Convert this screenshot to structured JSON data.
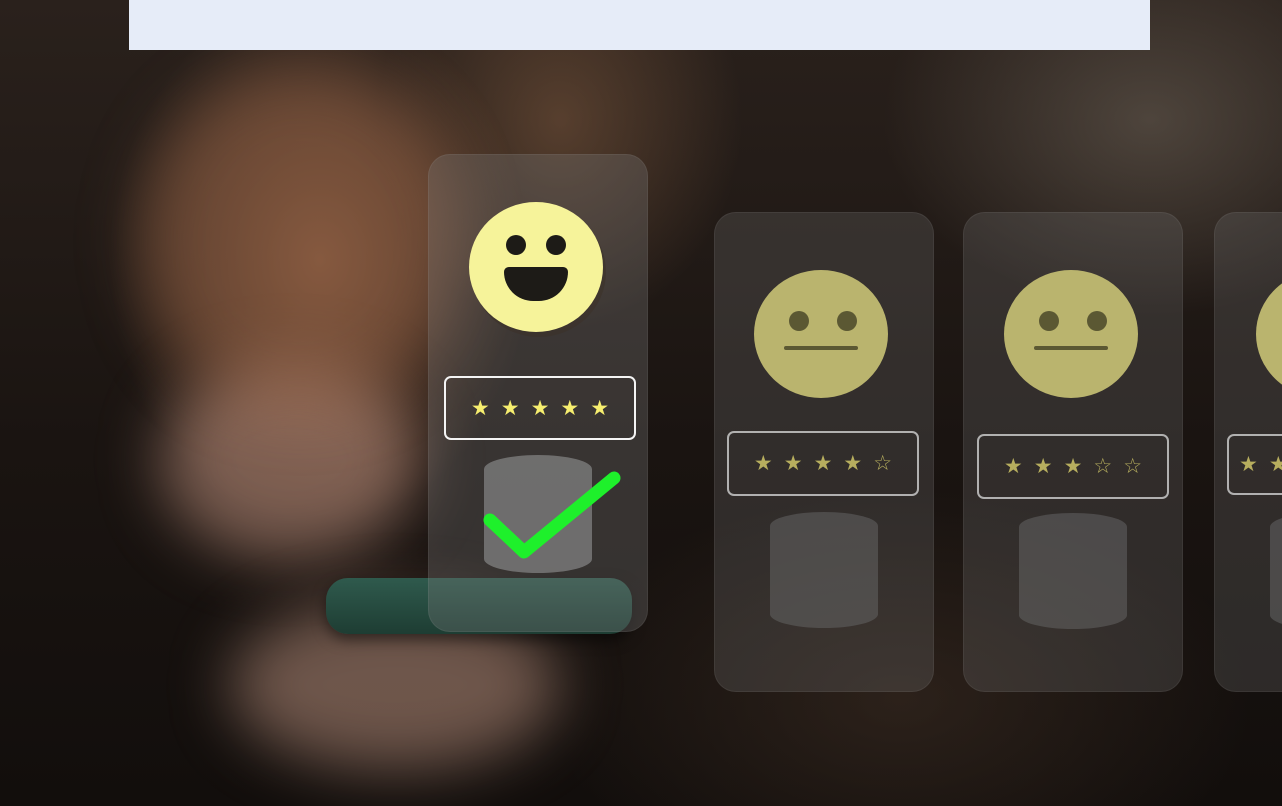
{
  "scene": {
    "main_card": {
      "face": "happy-face-icon",
      "stars": [
        "★",
        "★",
        "★",
        "★",
        "★"
      ],
      "rating": 5,
      "selected": true
    },
    "card_2": {
      "face": "neutral-face-icon",
      "stars": [
        "★",
        "★",
        "★",
        "★",
        "☆"
      ],
      "rating": 4
    },
    "card_3": {
      "face": "neutral-face-icon",
      "stars": [
        "★",
        "★",
        "★",
        "☆",
        "☆"
      ],
      "rating": 3
    },
    "card_4": {
      "face": "neutral-face-icon",
      "stars": [
        "★",
        "★"
      ],
      "rating": 2
    }
  },
  "colors": {
    "top_bar": "#e6ecf8",
    "happy_face": "#f6f39a",
    "neutral_face": "#bab46e",
    "star_bright": "#f6ee6f",
    "check": "#1ef02b",
    "phone": "#2f5a4d"
  }
}
